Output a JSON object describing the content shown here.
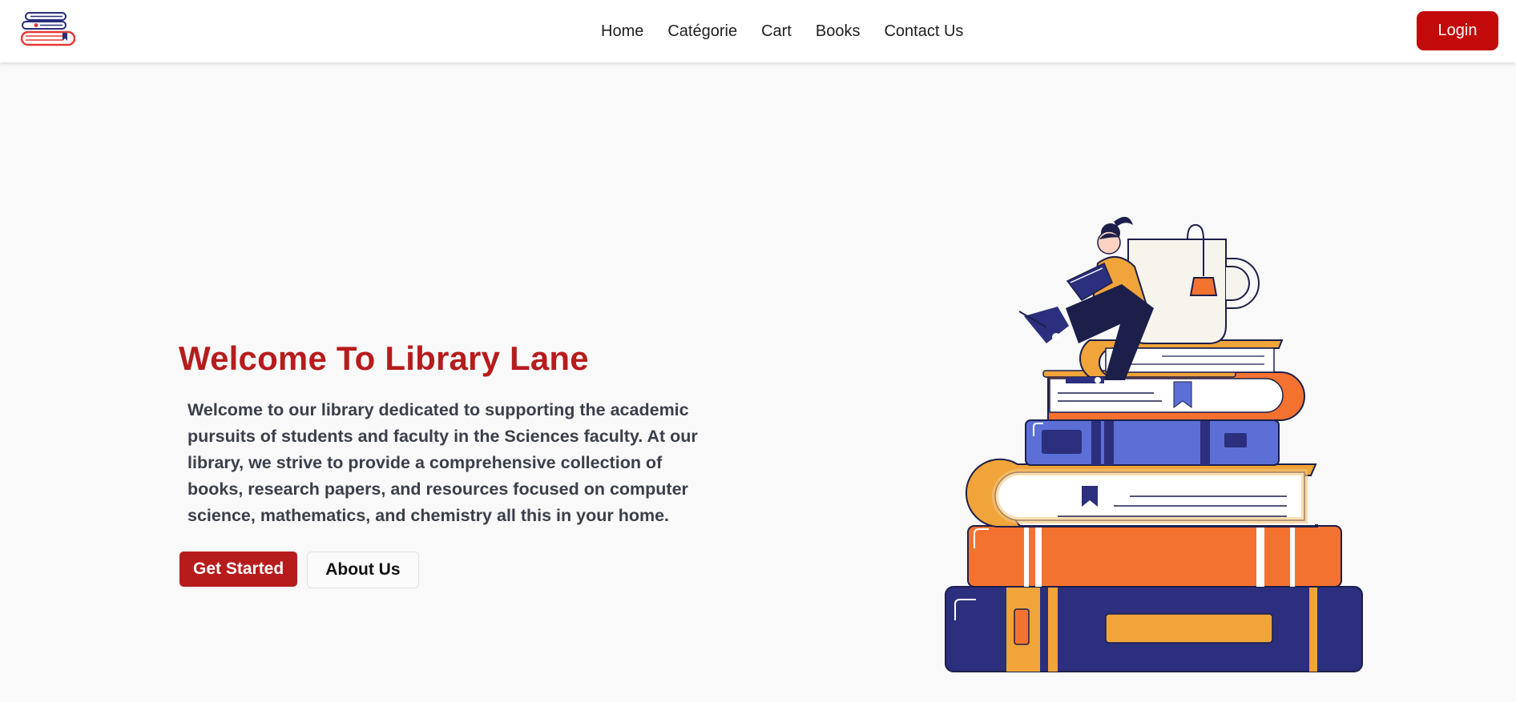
{
  "brand": {
    "logo_icon": "stacked-books-logo-icon"
  },
  "nav": {
    "links": [
      "Home",
      "Catégorie",
      "Cart",
      "Books",
      "Contact Us"
    ],
    "login_label": "Login"
  },
  "hero": {
    "title": "Welcome To Library Lane",
    "description": "Welcome to our library dedicated to supporting the academic pursuits of students and faculty in the Sciences faculty. At our library, we strive to provide a comprehensive collection of books, research papers, and resources focused on computer science, mathematics, and chemistry all this in your home.",
    "primary_button": "Get Started",
    "secondary_button": "About Us",
    "illustration_icon": "woman-reading-on-book-stack-illustration"
  },
  "colors": {
    "accent_red": "#b71c1c",
    "login_red": "#c20a0a",
    "navy": "#2b2f7d",
    "orange": "#f47230",
    "amber": "#f0a43a",
    "blue": "#5b6fd6"
  }
}
